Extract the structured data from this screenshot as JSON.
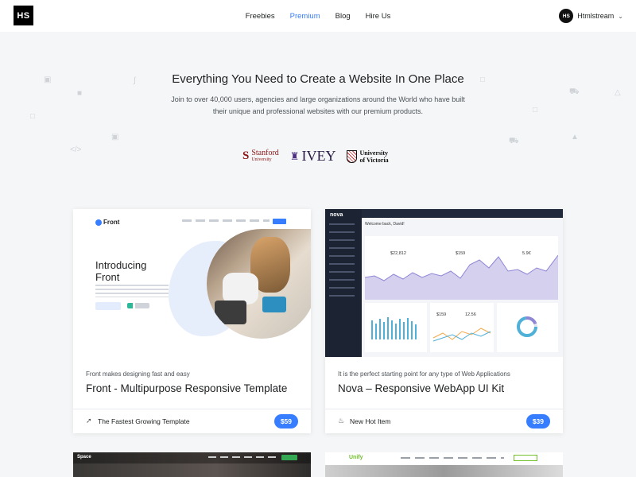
{
  "nav": {
    "logo": "HS",
    "links": [
      "Freebies",
      "Premium",
      "Blog",
      "Hire Us"
    ],
    "active": "Premium",
    "account_avatar": "HS",
    "account_name": "Htmlstream",
    "account_caret_icon": "chevron-down-icon"
  },
  "hero": {
    "title": "Everything You Need to Create a Website In One Place",
    "subtitle": "Join to over 40,000 users, agencies and large organizations around the World who have built their unique and professional websites with our premium products."
  },
  "clients": {
    "stanford_name": "Stanford",
    "stanford_sub": "University",
    "ivey": "IVEY",
    "victoria_line1": "University",
    "victoria_line2": "of Victoria"
  },
  "cards": [
    {
      "tagline": "Front makes designing fast and easy",
      "title": "Front - Multipurpose Responsive Template",
      "footer_label": "The Fastest Growing Template",
      "footer_icon": "rocket-icon",
      "price": "$59",
      "preview": {
        "brand": "Front",
        "headline": "Introducing Front"
      }
    },
    {
      "tagline": "It is the perfect starting point for any type of Web Applications",
      "title": "Nova – Responsive WebApp UI Kit",
      "footer_label": "New Hot Item",
      "footer_icon": "fire-icon",
      "price": "$39",
      "preview": {
        "brand": "nova",
        "welcome": "Welcome back, David!",
        "stat1": "$22,812",
        "stat2": "$159",
        "stat3": "5.9€",
        "stat4": "$159",
        "stat5": "12.56"
      }
    }
  ],
  "bottom_cards": [
    {
      "brand": "Space"
    },
    {
      "brand": "Unify"
    }
  ],
  "colors": {
    "accent": "#377dff",
    "background": "#f5f6f7"
  }
}
